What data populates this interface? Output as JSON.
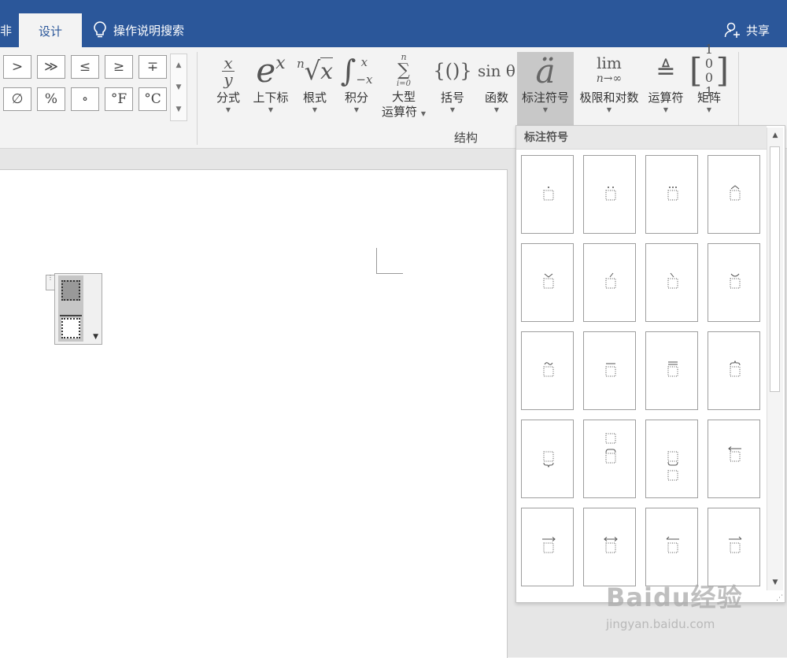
{
  "titlebar": {
    "left_cut_text": "⾮",
    "active_tab": "设计",
    "tell_me": "操作说明搜索",
    "share": "共享",
    "accent_color": "#2b579a"
  },
  "symbols": {
    "row1": [
      ">",
      "≫",
      "≤",
      "≥",
      "∓"
    ],
    "row2": [
      "∅",
      "%",
      "∘",
      "°F",
      "°C"
    ]
  },
  "structures": {
    "tools": [
      {
        "id": "fraction",
        "label": "分式"
      },
      {
        "id": "script",
        "label": "上下标"
      },
      {
        "id": "radical",
        "label": "根式"
      },
      {
        "id": "integral",
        "label": "积分"
      },
      {
        "id": "large-operator",
        "label": "大型",
        "label2": "运算符"
      },
      {
        "id": "bracket",
        "label": "括号"
      },
      {
        "id": "function",
        "label": "函数"
      },
      {
        "id": "accent",
        "label": "标注符号",
        "active": true
      },
      {
        "id": "limit-log",
        "label": "极限和对数"
      },
      {
        "id": "operator",
        "label": "运算符"
      },
      {
        "id": "matrix",
        "label": "矩阵"
      }
    ],
    "icons": {
      "fraction_num": "x",
      "fraction_den": "y",
      "script_base": "e",
      "script_sup": "x",
      "radical_index": "n",
      "radical_sym": "√",
      "radical_x": "x",
      "integral_sym": "∫",
      "integral_sup": "x",
      "integral_sub": "−x",
      "sum_top": "n",
      "sum_sym": "∑",
      "sum_bottom": "i=0",
      "bracket": "{()}",
      "function": "sin θ",
      "accent": "ä",
      "limit_top": "lim",
      "limit_bottom": "n→∞",
      "operator_sym": "≜",
      "matrix_top": "1 0",
      "matrix_bottom": "0 1"
    },
    "group_label": "结构"
  },
  "gallery": {
    "title": "标注符号",
    "items": [
      "dot",
      "double-dot",
      "triple-dot",
      "hat",
      "check",
      "acute",
      "grave",
      "breve",
      "tilde",
      "bar",
      "double-bar",
      "overbrace",
      "underbrace",
      "group-char-above",
      "group-char-below",
      "left-arrow-above",
      "right-arrow-above",
      "double-arrow-above",
      "left-harpoon-above",
      "right-harpoon-above"
    ]
  },
  "watermark": {
    "logo": "Baidu经验",
    "url": "jingyan.baidu.com"
  }
}
